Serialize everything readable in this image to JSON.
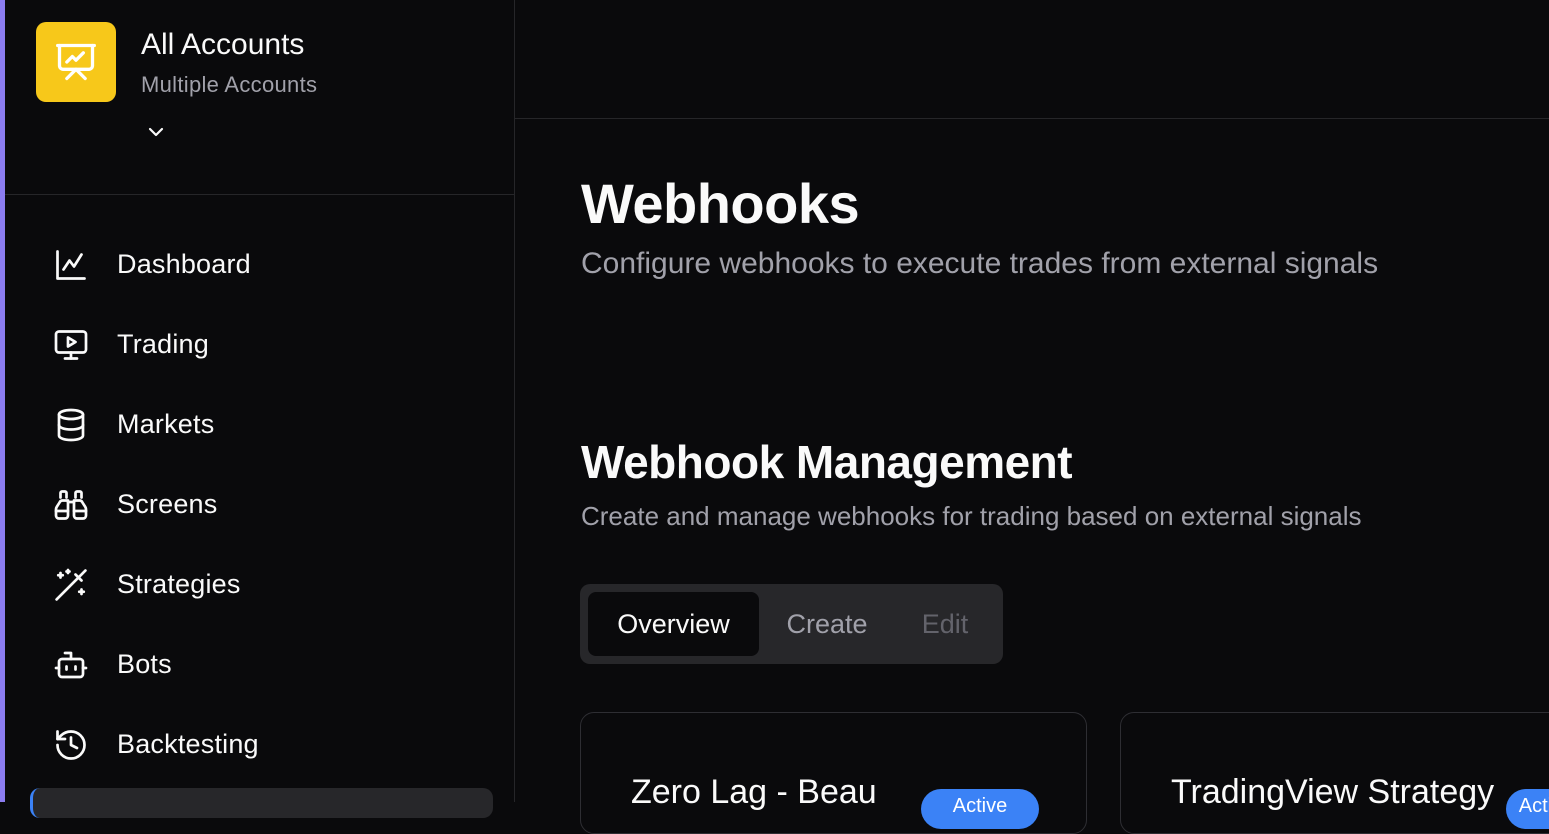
{
  "account": {
    "name": "All Accounts",
    "subtitle": "Multiple Accounts"
  },
  "nav": {
    "items": [
      {
        "label": "Dashboard",
        "icon": "chart-line-icon"
      },
      {
        "label": "Trading",
        "icon": "monitor-play-icon"
      },
      {
        "label": "Markets",
        "icon": "database-icon"
      },
      {
        "label": "Screens",
        "icon": "binoculars-icon"
      },
      {
        "label": "Strategies",
        "icon": "magic-wand-icon"
      },
      {
        "label": "Bots",
        "icon": "bot-icon"
      },
      {
        "label": "Backtesting",
        "icon": "history-icon"
      }
    ]
  },
  "page": {
    "title": "Webhooks",
    "subtitle": "Configure webhooks to execute trades from external signals"
  },
  "section": {
    "title": "Webhook Management",
    "subtitle": "Create and manage webhooks for trading based on external signals"
  },
  "tabs": {
    "overview": "Overview",
    "create": "Create",
    "edit": "Edit"
  },
  "cards": [
    {
      "title": "Zero Lag - Beau",
      "badge": "Active"
    },
    {
      "title": "TradingView Strategy",
      "badge": "Active"
    }
  ],
  "colors": {
    "accent": "#3b82f6",
    "logo": "#f7c81a",
    "background": "#0a0a0c"
  }
}
